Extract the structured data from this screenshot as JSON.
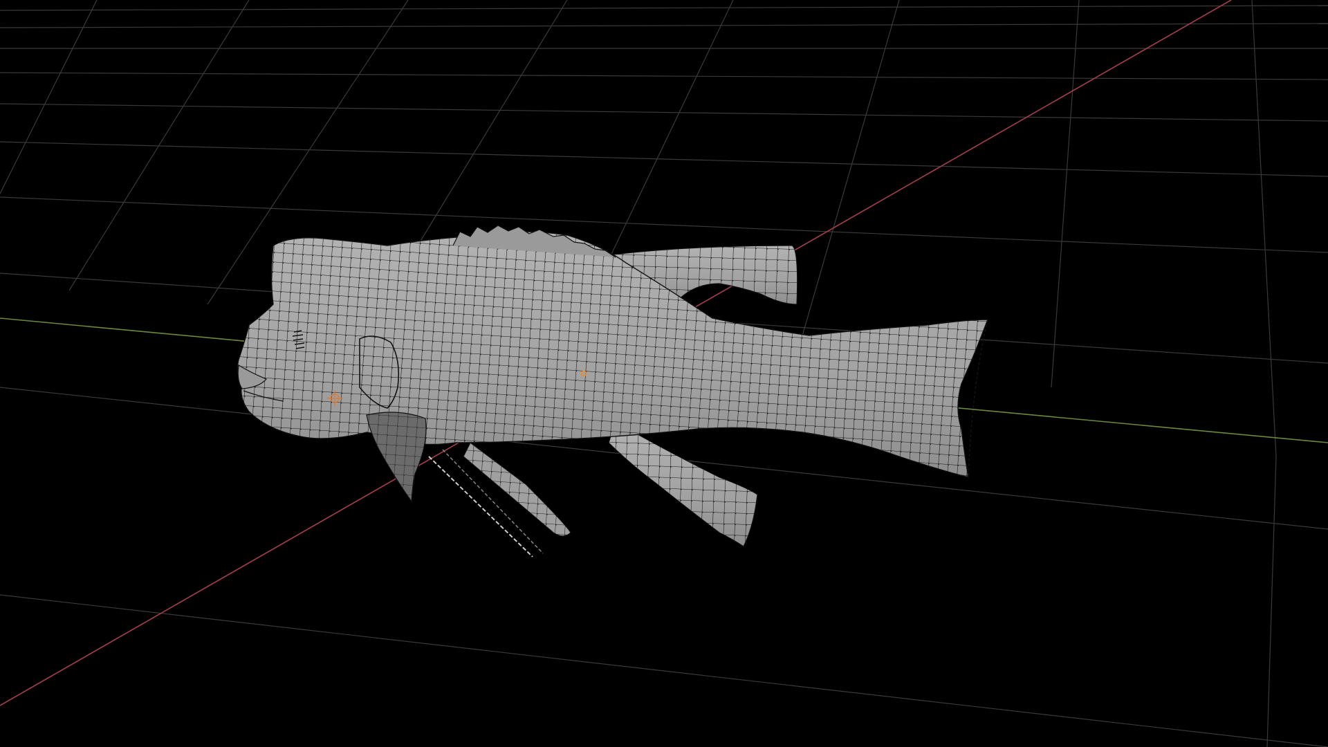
{
  "viewport": {
    "mode": "edit-mode-wireframe-overlay",
    "object": "fish-mesh",
    "colors": {
      "background": "#000000",
      "grid_line": "#3c3c3c",
      "x_axis": "#a6404a",
      "y_axis": "#6d8a3a",
      "mesh_fill": "#a7a7a7",
      "mesh_shade": "#8a8a8a",
      "mesh_wire": "#111111",
      "origin_point": "#f08a24"
    },
    "icons": [
      "object-origin-icon",
      "3d-cursor-icon"
    ]
  }
}
